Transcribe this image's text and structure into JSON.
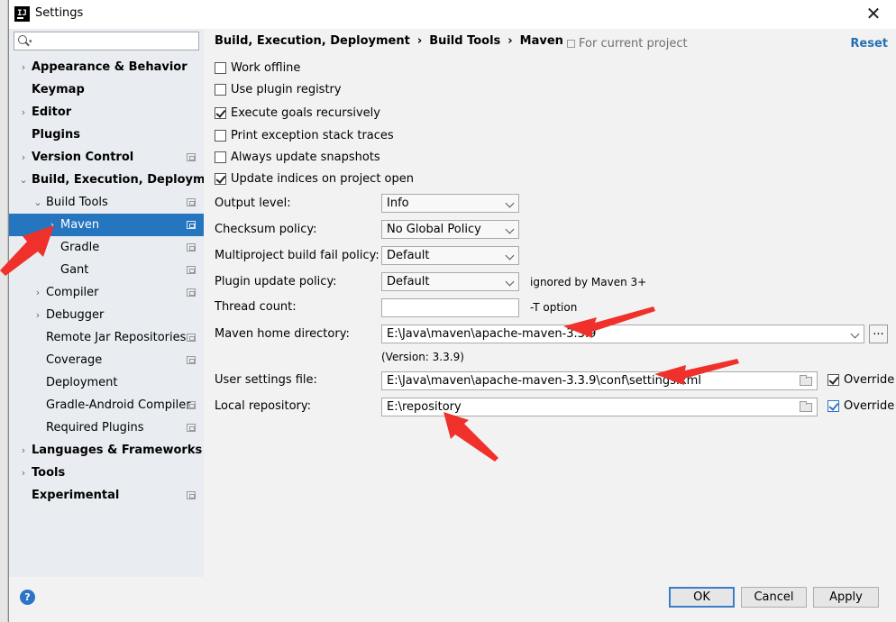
{
  "window": {
    "title": "Settings",
    "close_glyph": "✕"
  },
  "search": {
    "placeholder": ""
  },
  "sidebar": {
    "items": [
      {
        "label": "Appearance & Behavior",
        "level": 0,
        "arrow": "›",
        "bold": true,
        "proj": false
      },
      {
        "label": "Keymap",
        "level": 0,
        "arrow": "",
        "bold": true,
        "proj": false
      },
      {
        "label": "Editor",
        "level": 0,
        "arrow": "›",
        "bold": true,
        "proj": false
      },
      {
        "label": "Plugins",
        "level": 0,
        "arrow": "",
        "bold": true,
        "proj": false
      },
      {
        "label": "Version Control",
        "level": 0,
        "arrow": "›",
        "bold": true,
        "proj": true
      },
      {
        "label": "Build, Execution, Deployment",
        "level": 0,
        "arrow": "⌄",
        "bold": true,
        "proj": false
      },
      {
        "label": "Build Tools",
        "level": 1,
        "arrow": "⌄",
        "bold": false,
        "proj": true
      },
      {
        "label": "Maven",
        "level": 2,
        "arrow": "›",
        "bold": false,
        "proj": true,
        "selected": true
      },
      {
        "label": "Gradle",
        "level": 2,
        "arrow": "",
        "bold": false,
        "proj": true
      },
      {
        "label": "Gant",
        "level": 2,
        "arrow": "",
        "bold": false,
        "proj": true
      },
      {
        "label": "Compiler",
        "level": 1,
        "arrow": "›",
        "bold": false,
        "proj": true
      },
      {
        "label": "Debugger",
        "level": 1,
        "arrow": "›",
        "bold": false,
        "proj": false
      },
      {
        "label": "Remote Jar Repositories",
        "level": 1,
        "arrow": "",
        "bold": false,
        "proj": true
      },
      {
        "label": "Coverage",
        "level": 1,
        "arrow": "",
        "bold": false,
        "proj": true
      },
      {
        "label": "Deployment",
        "level": 1,
        "arrow": "",
        "bold": false,
        "proj": false
      },
      {
        "label": "Gradle-Android Compiler",
        "level": 1,
        "arrow": "",
        "bold": false,
        "proj": true
      },
      {
        "label": "Required Plugins",
        "level": 1,
        "arrow": "",
        "bold": false,
        "proj": true
      },
      {
        "label": "Languages & Frameworks",
        "level": 0,
        "arrow": "›",
        "bold": true,
        "proj": false
      },
      {
        "label": "Tools",
        "level": 0,
        "arrow": "›",
        "bold": true,
        "proj": false
      },
      {
        "label": "Experimental",
        "level": 0,
        "arrow": "",
        "bold": true,
        "proj": true
      }
    ]
  },
  "breadcrumb": {
    "part1": "Build, Execution, Deployment",
    "part2": "Build Tools",
    "part3": "Maven",
    "sep": "›"
  },
  "header": {
    "for_project": "For current project",
    "reset": "Reset"
  },
  "checkboxes": {
    "work_offline": {
      "label": "Work offline",
      "checked": false
    },
    "plugin_registry": {
      "label": "Use plugin registry",
      "checked": false
    },
    "execute_goals": {
      "label": "Execute goals recursively",
      "checked": true
    },
    "print_exception": {
      "label": "Print exception stack traces",
      "checked": false
    },
    "update_snapshots": {
      "label": "Always update snapshots",
      "checked": false
    },
    "update_indices": {
      "label": "Update indices on project open",
      "checked": true
    }
  },
  "form": {
    "output_level": {
      "label": "Output level:",
      "value": "Info"
    },
    "checksum_policy": {
      "label": "Checksum policy:",
      "value": "No Global Policy"
    },
    "multiproject_fail": {
      "label": "Multiproject build fail policy:",
      "value": "Default"
    },
    "plugin_update": {
      "label": "Plugin update policy:",
      "value": "Default",
      "hint": "ignored by Maven 3+"
    },
    "thread_count": {
      "label": "Thread count:",
      "value": "",
      "hint": "-T option"
    },
    "maven_home": {
      "label": "Maven home directory:",
      "value": "E:\\Java\\maven\\apache-maven-3.3.9",
      "button": "...",
      "version": "(Version: 3.3.9)"
    },
    "user_settings": {
      "label": "User settings file:",
      "value": "E:\\Java\\maven\\apache-maven-3.3.9\\conf\\settings.xml",
      "override_label": "Override",
      "override": true
    },
    "local_repo": {
      "label": "Local repository:",
      "value": "E:\\repository",
      "override_label": "Override",
      "override": true
    }
  },
  "footer": {
    "help": "?",
    "ok": "OK",
    "cancel": "Cancel",
    "apply": "Apply"
  },
  "colors": {
    "selection": "#2675bf",
    "link": "#2470b3",
    "annotation_arrow": "#f0302a"
  }
}
